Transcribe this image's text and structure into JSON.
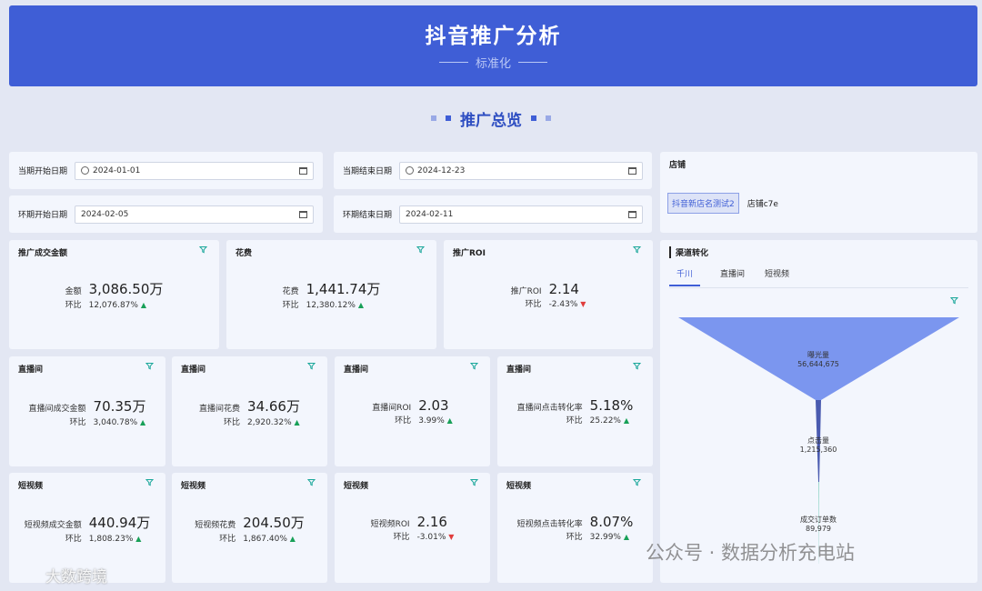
{
  "header": {
    "title": "抖音推广分析",
    "subtitle": "标准化"
  },
  "section": {
    "title": "推广总览"
  },
  "filters": [
    {
      "label": "当期开始日期",
      "value": "2024-01-01",
      "clock": true
    },
    {
      "label": "当期结束日期",
      "value": "2024-12-23",
      "clock": true
    },
    {
      "label": "环期开始日期",
      "value": "2024-02-05",
      "clock": false
    },
    {
      "label": "环期结束日期",
      "value": "2024-02-11",
      "clock": false
    }
  ],
  "store": {
    "title": "店铺",
    "tags": [
      "抖音新店名测试2",
      "店铺c7e"
    ]
  },
  "summary_cards": [
    {
      "title": "推广成交金额",
      "label": "金额",
      "value": "3,086.50万",
      "cmp_label": "环比",
      "cmp_value": "12,076.87%",
      "trend": "up"
    },
    {
      "title": "花费",
      "label": "花费",
      "value": "1,441.74万",
      "cmp_label": "环比",
      "cmp_value": "12,380.12%",
      "trend": "up"
    },
    {
      "title": "推广ROI",
      "label": "推广ROI",
      "value": "2.14",
      "cmp_label": "环比",
      "cmp_value": "-2.43%",
      "trend": "down"
    }
  ],
  "live_cards": [
    {
      "title": "直播间",
      "label": "直播间成交金额",
      "value": "70.35万",
      "cmp_label": "环比",
      "cmp_value": "3,040.78%",
      "trend": "up"
    },
    {
      "title": "直播间",
      "label": "直播间花费",
      "value": "34.66万",
      "cmp_label": "环比",
      "cmp_value": "2,920.32%",
      "trend": "up"
    },
    {
      "title": "直播间",
      "label": "直播间ROI",
      "value": "2.03",
      "cmp_label": "环比",
      "cmp_value": "3.99%",
      "trend": "up"
    },
    {
      "title": "直播间",
      "label": "直播间点击转化率",
      "value": "5.18%",
      "cmp_label": "环比",
      "cmp_value": "25.22%",
      "trend": "up"
    }
  ],
  "video_cards": [
    {
      "title": "短视频",
      "label": "短视频成交金额",
      "value": "440.94万",
      "cmp_label": "环比",
      "cmp_value": "1,808.23%",
      "trend": "up"
    },
    {
      "title": "短视频",
      "label": "短视频花费",
      "value": "204.50万",
      "cmp_label": "环比",
      "cmp_value": "1,867.40%",
      "trend": "up"
    },
    {
      "title": "短视频",
      "label": "短视频ROI",
      "value": "2.16",
      "cmp_label": "环比",
      "cmp_value": "-3.01%",
      "trend": "down"
    },
    {
      "title": "短视频",
      "label": "短视频点击转化率",
      "value": "8.07%",
      "cmp_label": "环比",
      "cmp_value": "32.99%",
      "trend": "up"
    }
  ],
  "funnel": {
    "title": "渠道转化",
    "tabs": [
      "千川",
      "直播间",
      "短视频"
    ],
    "active_tab": 0,
    "stages": [
      {
        "name": "曝光量",
        "value": "56,644,675"
      },
      {
        "name": "点击量",
        "value": "1,215,360"
      },
      {
        "name": "成交订单数",
        "value": "89,979"
      }
    ]
  },
  "watermarks": {
    "wechat": "公众号 · 数据分析充电站",
    "brand": "大数跨境"
  },
  "colors": {
    "primary": "#3f5ed6",
    "up": "#18a058",
    "down": "#e03c3c",
    "funnel_top": "#7b96ef",
    "funnel_mid": "#4a5bb0"
  },
  "icons": {
    "filter": "filter-icon",
    "calendar": "calendar-icon",
    "clock": "clock-icon"
  }
}
